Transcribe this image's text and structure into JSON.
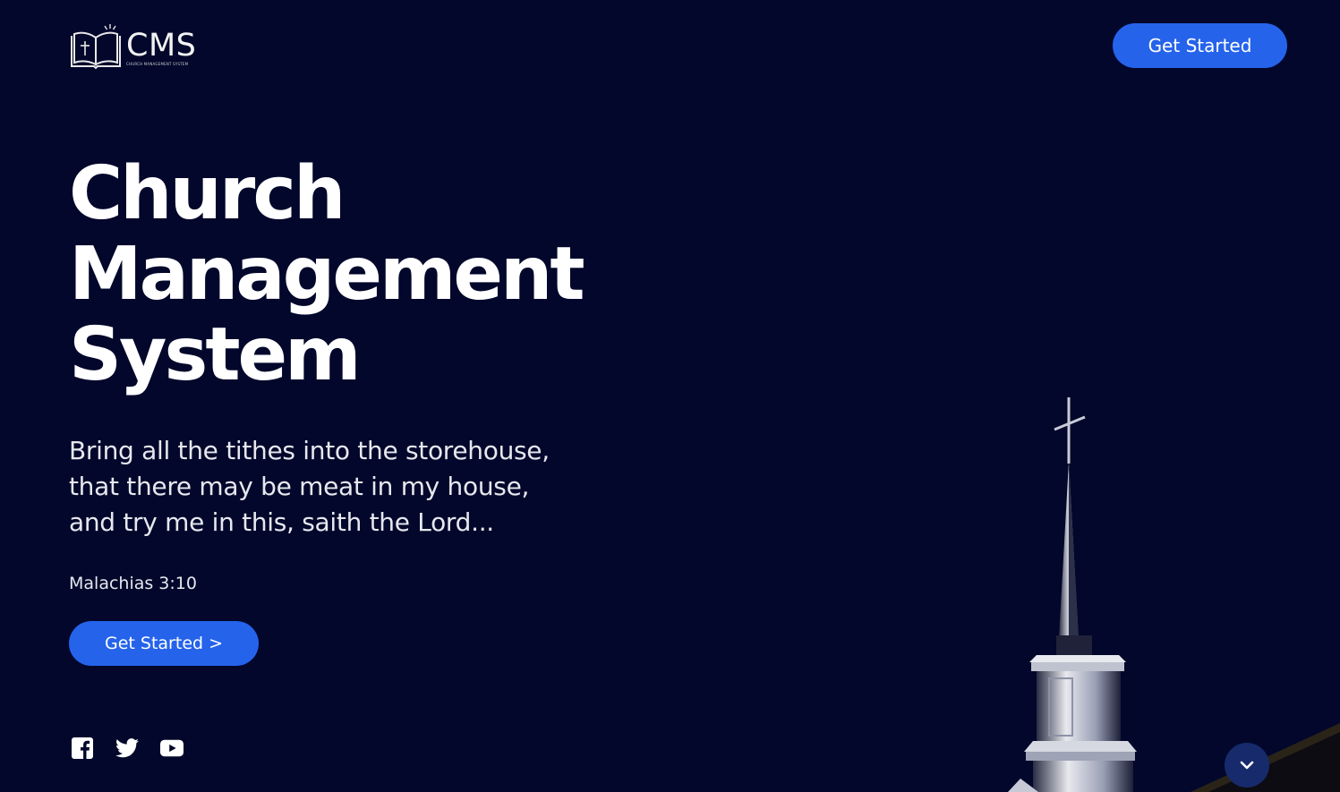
{
  "header": {
    "logo_text": "CMS",
    "logo_subtitle": "CHURCH MANAGEMENT SYSTEM",
    "cta_label": "Get Started"
  },
  "hero": {
    "title_lines": [
      "Church",
      "Management",
      "System"
    ],
    "quote_lines": [
      "Bring all the tithes into the storehouse,",
      "that there may be meat in my house,",
      "and try me in this, saith the Lord..."
    ],
    "verse_reference": "Malachias 3:10",
    "cta_label": "Get Started",
    "cta_arrow": ">"
  },
  "socials": [
    {
      "icon": "facebook-icon"
    },
    {
      "icon": "twitter-icon"
    },
    {
      "icon": "youtube-icon"
    }
  ],
  "scroll_down": {
    "icon": "chevron-down-icon"
  },
  "colors": {
    "background": "#02072b",
    "accent": "#2563eb",
    "scroll_button": "#172a6b"
  }
}
